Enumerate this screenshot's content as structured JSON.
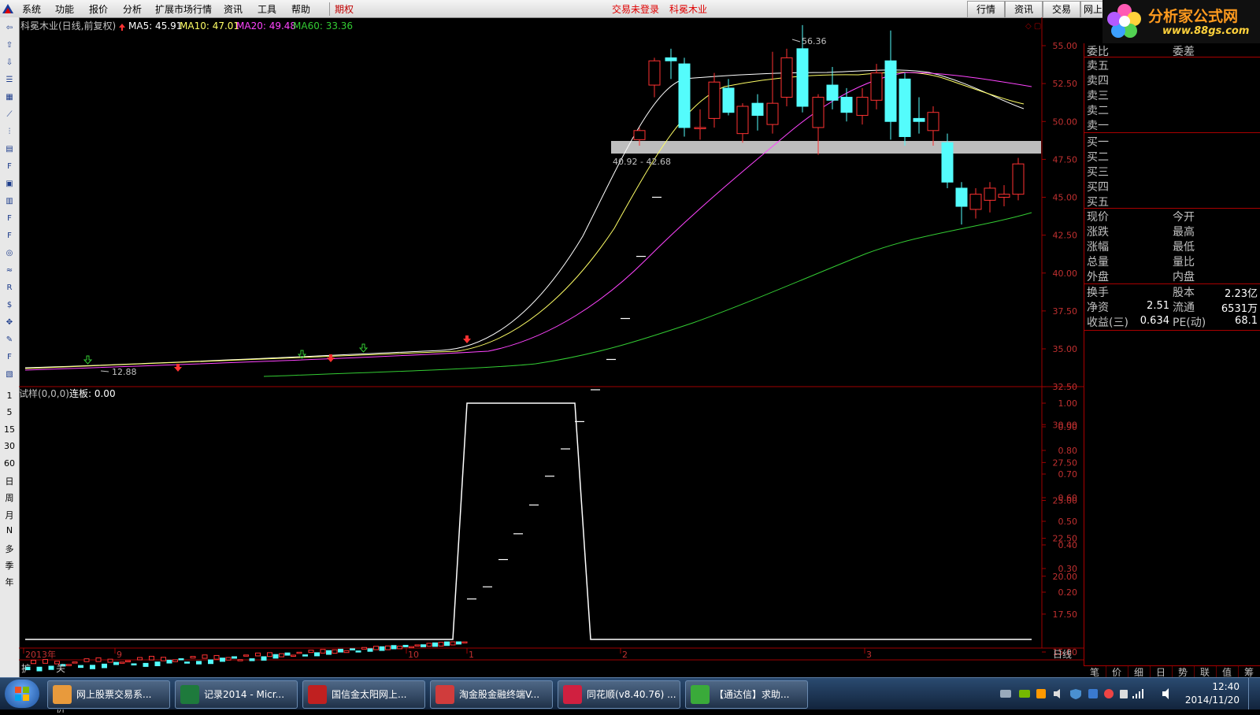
{
  "menu": {
    "items": [
      "系统",
      "功能",
      "报价",
      "分析",
      "扩展市场行情",
      "资讯",
      "工具",
      "帮助"
    ],
    "options_label": "期权",
    "status_login": "交易未登录",
    "status_stock": "科冕木业",
    "tabs": [
      "行情",
      "资讯",
      "交易",
      "网上"
    ]
  },
  "brand": {
    "name": "分析家公式网",
    "url": "www.88gs.com"
  },
  "stock_header": {
    "title": "科冕木业(日线,前复权)",
    "ma5": "MA5: 45.91",
    "ma10": "MA10: 47.01",
    "ma20": "MA20: 49.48",
    "ma60": "MA60: 33.36"
  },
  "annotations": {
    "high": "56.36",
    "low": "12.88",
    "zone": "40.92 - 42.68"
  },
  "indicator_header": {
    "name": "试样(0,0,0)",
    "value": "连板: 0.00"
  },
  "price_axis_labels": [
    "55.00",
    "52.50",
    "50.00",
    "47.50",
    "45.00",
    "42.50",
    "40.00",
    "37.50",
    "35.00",
    "32.50",
    "30.00",
    "27.50",
    "25.00",
    "22.50",
    "20.00",
    "17.50",
    "15.00"
  ],
  "indicator_axis_labels": [
    "1.00",
    "0.90",
    "0.80",
    "0.70",
    "0.60",
    "0.50",
    "0.40",
    "0.30",
    "0.20"
  ],
  "date_labels": [
    "2013年",
    "9",
    "10",
    "1",
    "2",
    "3"
  ],
  "period_label": "日线",
  "bottom_tabs": [
    "扩展八",
    "关联报价"
  ],
  "toolbar": {
    "icons": [
      "back-icon",
      "up-icon",
      "down-icon",
      "list-icon",
      "grid-icon",
      "line-chart-icon",
      "candle-icon",
      "news-icon",
      "f10-icon",
      "notes-icon",
      "calc-icon",
      "f12-icon",
      "f6-icon",
      "circle-icon",
      "wave-icon",
      "rsi-icon",
      "money-icon",
      "move-icon",
      "pencil-icon",
      "f5-icon",
      "tile-icon"
    ],
    "periods": [
      "1",
      "5",
      "15",
      "30",
      "60",
      "日",
      "周",
      "月",
      "N",
      "多",
      "季",
      "年"
    ]
  },
  "panel": {
    "weibi": "委比",
    "weicha": "委差",
    "sell": [
      "卖五",
      "卖四",
      "卖三",
      "卖二",
      "卖一"
    ],
    "buy": [
      "买一",
      "买二",
      "买三",
      "买四",
      "买五"
    ],
    "quote_left": [
      "现价",
      "涨跌",
      "涨幅",
      "总量",
      "外盘"
    ],
    "quote_right": [
      "今开",
      "最高",
      "最低",
      "量比",
      "内盘"
    ],
    "stats": [
      {
        "l1": "换手",
        "v1": "",
        "l2": "股本",
        "v2": "2.23亿"
      },
      {
        "l1": "净资",
        "v1": "2.51",
        "l2": "流通",
        "v2": "6531万"
      },
      {
        "l1": "收益(三)",
        "v1": "0.634",
        "l2": "PE(动)",
        "v2": "68.1"
      }
    ],
    "tabs": [
      "笔",
      "价",
      "细",
      "日",
      "势",
      "联",
      "值",
      "筹"
    ]
  },
  "taskbar": {
    "items": [
      "网上股票交易系...",
      "记录2014 - Micr...",
      "国信金太阳网上...",
      "淘金股金融终端V...",
      "同花顺(v8.40.76) ...",
      "【通达信】求助..."
    ],
    "time": "12:40",
    "date": "2014/11/20"
  },
  "colors": {
    "up": "#ff3232",
    "down": "#54fcfc",
    "ma5": "#ffffff",
    "ma10": "#ffff66",
    "ma20": "#ff44ff",
    "ma60": "#33cc33",
    "frame": "#a00000"
  }
}
